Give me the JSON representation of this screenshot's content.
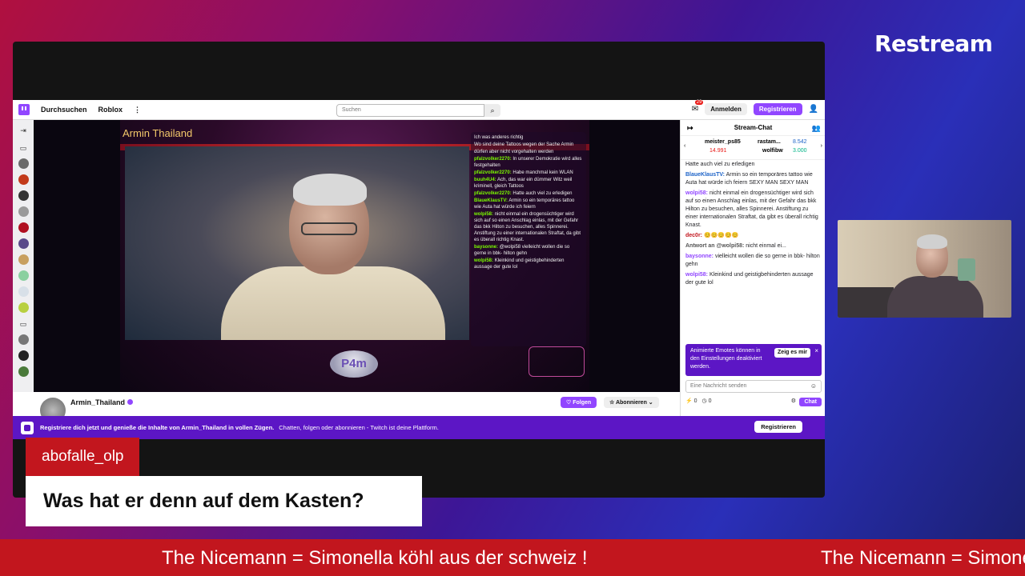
{
  "brand": "Restream",
  "twitch": {
    "nav": {
      "browse": "Durchsuchen",
      "roblox": "Roblox",
      "more": "⋮",
      "search_placeholder": "Suchen",
      "notifications_count": "29",
      "login": "Anmelden",
      "register": "Registrieren"
    },
    "player": {
      "stream_title": "Armin Thailand",
      "logo_text": "P4m",
      "overlay_chat": [
        {
          "name": "",
          "text": "Ich was anderes richtig"
        },
        {
          "name": "",
          "text": "Wo sind deine Tattoos wegen der Sache Armin"
        },
        {
          "name": "",
          "text": "dürfen aber nicht vorgehalten werden"
        },
        {
          "name": "pfalzvolker2270:",
          "text": "In unserer Demokratie wird alles festgehalten"
        },
        {
          "name": "pfalzvolker2270:",
          "text": "Habe manchmal kein WLAN"
        },
        {
          "name": "buuh4U4:",
          "text": "Ach, das war ein dümmer Witz weil kriminell, gleich Tattoos"
        },
        {
          "name": "pfalzvolker2270:",
          "text": "Hatte auch viel zu erledigen"
        },
        {
          "name": "BlaueKlausTV:",
          "text": "Armin so ein temporäres tattoo wie Auta hat würde ich feiern"
        },
        {
          "name": "wolpi58:",
          "text": "nicht einmal ein drogensüchtiger wird sich auf so einen Anschlag einlas, mit der Gefahr das bkk Hilton zu besuchen, alles Spinnerei. Anstiftung zu einer internationalen Straftat, da gibt es überall richtig Knast."
        },
        {
          "name": "baysonne:",
          "text": "@wolpi58 vielleicht wollen die so gerne in bbk- hilton gehn"
        },
        {
          "name": "wolpi58:",
          "text": "Kleinkind und geistigbehinderten aussage der gute lol"
        }
      ]
    },
    "channel": {
      "streamer": "Armin_Thailand",
      "follow": "♡ Folgen",
      "subscribe": "☆ Abonnieren ⌄"
    },
    "chat": {
      "header": "Stream-Chat",
      "leaders": [
        {
          "name": "meister_ps85",
          "value": "14.991"
        },
        {
          "name": "rastam...",
          "value": "8.542"
        },
        {
          "name": "wolfibw",
          "value": "3.000"
        }
      ],
      "messages": [
        {
          "name": "",
          "text": "Hatte auch viel zu erledigen",
          "color": "#1f1f23"
        },
        {
          "name": "BlaueKlausTV:",
          "text": "Armin so ein temporäres tattoo wie Auta hat würde ich feiern SEXY MAN SEXY MAN",
          "color": "#1e64c8"
        },
        {
          "name": "wolpi58:",
          "text": "nicht einmal ein drogensüchtiger wird sich auf so einen Anschlag einlas, mit der Gefahr das bkk Hilton zu besuchen, alles Spinnerei. Anstiftung zu einer internationalen Straftat, da gibt es überall richtig Knast.",
          "color": "#9146ff"
        },
        {
          "name": "dec0r:",
          "text": "😊😊😊😊😊",
          "color": "#c2161e"
        },
        {
          "name": "Antwort an @wolpi58:",
          "text": "nicht einmal ei...",
          "color": "#555555"
        },
        {
          "name": "baysonne:",
          "text": "vielleicht wollen die so gerne in bbk- hilton gehn",
          "color": "#9146ff"
        },
        {
          "name": "wolpi58:",
          "text": "Kleinkind und geistigbehinderten aussage der gute lol",
          "color": "#9146ff"
        }
      ],
      "promo_text": "Animierte Emotes können in den Einstellungen deaktiviert werden.",
      "promo_button": "Zeig es mir",
      "input_placeholder": "Eine Nachricht senden",
      "points_a": "0",
      "points_b": "0",
      "send": "Chat"
    },
    "register_bar": {
      "bold": "Registriere dich jetzt und genieße die Inhalte von Armin_Thailand in vollen Zügen.",
      "text": "Chatten, folgen oder abonnieren - Twitch ist deine Plattform.",
      "button": "Registrieren"
    }
  },
  "lower_third": {
    "name": "abofalle_olp",
    "title": "Was hat er denn auf dem Kasten?"
  },
  "ticker": {
    "text": "The Nicemann = Simonella köhl aus der schweiz !"
  },
  "colors": {
    "accent": "#9146ff",
    "ticker_red": "#c2161e"
  }
}
